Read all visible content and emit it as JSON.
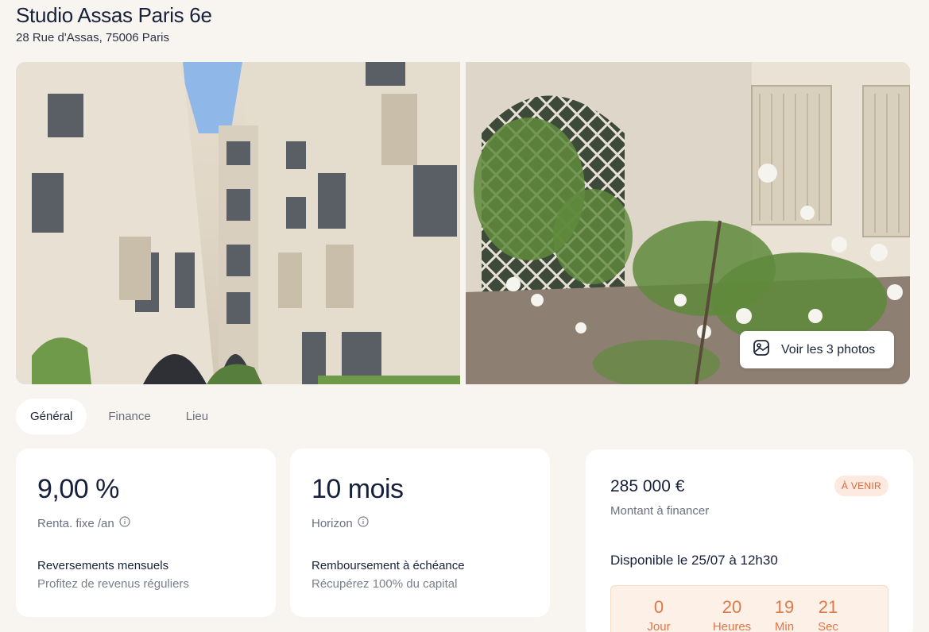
{
  "listing": {
    "title": "Studio Assas Paris 6e",
    "address": "28 Rue d'Assas, 75006 Paris"
  },
  "gallery": {
    "button_label": "Voir les 3 photos",
    "button_icon": "image-icon"
  },
  "tabs": [
    {
      "label": "Général",
      "active": true
    },
    {
      "label": "Finance",
      "active": false
    },
    {
      "label": "Lieu",
      "active": false
    }
  ],
  "stats": [
    {
      "value": "9,00 %",
      "label": "Renta. fixe /an",
      "feature_title": "Reversements mensuels",
      "feature_desc": "Profitez de revenus réguliers"
    },
    {
      "value": "10 mois",
      "label": "Horizon",
      "feature_title": "Remboursement à échéance",
      "feature_desc": "Récupérez 100% du capital"
    }
  ],
  "funding": {
    "amount": "285 000 €",
    "amount_label": "Montant à financer",
    "status_badge": "À VENIR",
    "available": "Disponible le 25/07 à 12h30",
    "countdown": [
      {
        "value": "0",
        "label": "Jour"
      },
      {
        "value": "20",
        "label": "Heures"
      },
      {
        "value": "19",
        "label": "Min"
      },
      {
        "value": "21",
        "label": "Sec"
      }
    ]
  },
  "colors": {
    "background": "#f8f5f0",
    "card": "#ffffff",
    "accent": "#e0774a",
    "badge_bg": "#fde9df",
    "text_primary": "#18213a",
    "text_secondary": "#6b7181"
  }
}
